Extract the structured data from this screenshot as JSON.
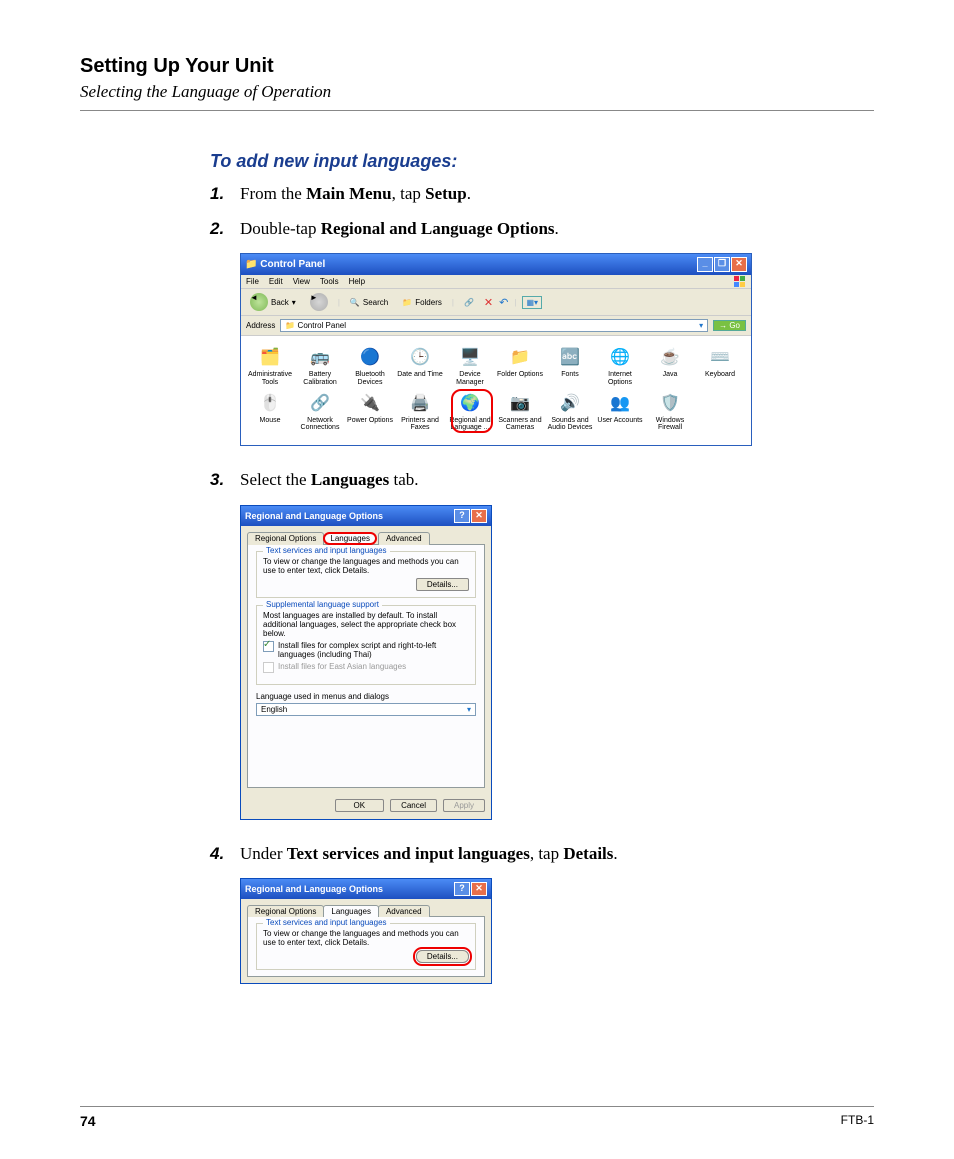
{
  "header": {
    "title": "Setting Up Your Unit",
    "subtitle": "Selecting the Language of Operation"
  },
  "section_title": "To add new input languages:",
  "steps": {
    "s1_pre": "From the ",
    "s1_b1": "Main Menu",
    "s1_mid": ", tap ",
    "s1_b2": "Setup",
    "s1_post": ".",
    "s2_pre": "Double-tap ",
    "s2_b1": "Regional and Language Options",
    "s2_post": ".",
    "s3_pre": "Select the ",
    "s3_b1": "Languages",
    "s3_post": " tab.",
    "s4_pre": "Under ",
    "s4_b1": "Text services and input languages",
    "s4_mid": ", tap ",
    "s4_b2": "Details",
    "s4_post": ".",
    "n1": "1.",
    "n2": "2.",
    "n3": "3.",
    "n4": "4."
  },
  "cp": {
    "title": "Control Panel",
    "menu": [
      "File",
      "Edit",
      "View",
      "Tools",
      "Help"
    ],
    "toolbar": {
      "back": "Back",
      "search": "Search",
      "folders": "Folders"
    },
    "address_label": "Address",
    "address_value": "Control Panel",
    "go": "Go",
    "items_row1": [
      {
        "l1": "Administrative",
        "l2": "Tools",
        "ic": "🗂️"
      },
      {
        "l1": "Battery",
        "l2": "Calibration",
        "ic": "🚌"
      },
      {
        "l1": "Bluetooth",
        "l2": "Devices",
        "ic": "🔵"
      },
      {
        "l1": "Date and Time",
        "l2": "",
        "ic": "🕒"
      },
      {
        "l1": "Device",
        "l2": "Manager",
        "ic": "🖥️"
      },
      {
        "l1": "Folder Options",
        "l2": "",
        "ic": "📁"
      },
      {
        "l1": "Fonts",
        "l2": "",
        "ic": "🔤"
      },
      {
        "l1": "Internet",
        "l2": "Options",
        "ic": "🌐"
      },
      {
        "l1": "Java",
        "l2": "",
        "ic": "☕"
      },
      {
        "l1": "Keyboard",
        "l2": "",
        "ic": "⌨️"
      }
    ],
    "items_row2": [
      {
        "l1": "Mouse",
        "l2": "",
        "ic": "🖱️"
      },
      {
        "l1": "Network",
        "l2": "Connections",
        "ic": "🔗"
      },
      {
        "l1": "Power Options",
        "l2": "",
        "ic": "🔌"
      },
      {
        "l1": "Printers and",
        "l2": "Faxes",
        "ic": "🖨️"
      },
      {
        "l1": "Regional and",
        "l2": "Language ...",
        "ic": "🌍",
        "hl": true
      },
      {
        "l1": "Scanners and",
        "l2": "Cameras",
        "ic": "📷"
      },
      {
        "l1": "Sounds and",
        "l2": "Audio Devices",
        "ic": "🔊"
      },
      {
        "l1": "User Accounts",
        "l2": "",
        "ic": "👥"
      },
      {
        "l1": "Windows",
        "l2": "Firewall",
        "ic": "🛡️"
      }
    ]
  },
  "dlg": {
    "title": "Regional and Language Options",
    "tabs": {
      "t1": "Regional Options",
      "t2": "Languages",
      "t3": "Advanced"
    },
    "grp1_title": "Text services and input languages",
    "grp1_text": "To view or change the languages and methods you can use to enter text, click Details.",
    "details": "Details...",
    "grp2_title": "Supplemental language support",
    "grp2_text": "Most languages are installed by default. To install additional languages, select the appropriate check box below.",
    "chk1": "Install files for complex script and right-to-left languages (including Thai)",
    "chk2": "Install files for East Asian languages",
    "lang_used": "Language used in menus and dialogs",
    "lang_sel": "English",
    "ok": "OK",
    "cancel": "Cancel",
    "apply": "Apply"
  },
  "footer": {
    "page": "74",
    "doc": "FTB-1"
  }
}
